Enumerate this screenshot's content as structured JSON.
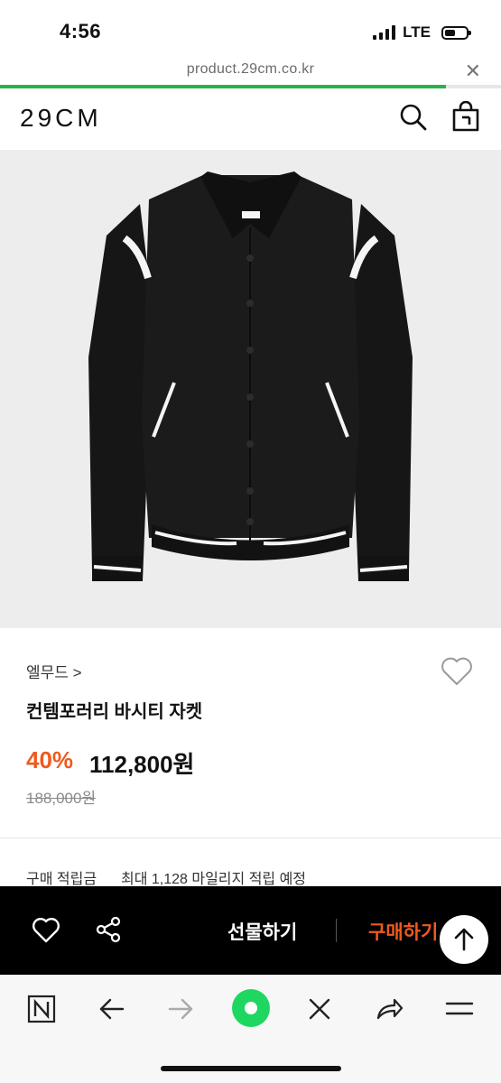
{
  "status_bar": {
    "time": "4:56",
    "network": "LTE"
  },
  "browser": {
    "url": "product.29cm.co.kr",
    "load_progress": 0.89
  },
  "header": {
    "logo": "29CM",
    "search_icon": "search-icon",
    "cart_icon": "shopping-bag-icon"
  },
  "product": {
    "image_icon": "varsity-jacket-image",
    "brand": "엘무드 >",
    "name": "컨템포러리 바시티 자켓",
    "discount": "40%",
    "price": "112,800원",
    "original_price": "188,000원",
    "points_label": "구매 적립금",
    "points_value": "최대 1,128 마일리지 적립 예정"
  },
  "purchase_bar": {
    "like_icon": "heart-icon",
    "share_icon": "share-icon",
    "gift_label": "선물하기",
    "buy_label": "구매하기",
    "top_icon": "arrow-up-icon"
  },
  "toolbar": {
    "icons": [
      "naver-n-icon",
      "back-arrow-icon",
      "forward-arrow-icon",
      "green-dot-icon",
      "close-icon",
      "share-arrow-icon",
      "menu-icon"
    ]
  },
  "colors": {
    "accent": "#ef5a1e",
    "progress": "#27b24a",
    "green_button": "#1ed760"
  }
}
